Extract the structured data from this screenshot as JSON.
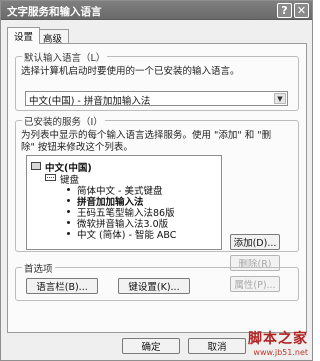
{
  "window": {
    "title": "文字服务和输入语言",
    "help_button": "?",
    "close_button": "✕"
  },
  "tabs": [
    "设置",
    "高级"
  ],
  "default_lang": {
    "group_label": "默认输入语言（L）",
    "description": "选择计算机启动时要使用的一个已安装的输入语言。",
    "selected_value": "中文(中国) - 拼音加加输入法"
  },
  "installed": {
    "group_label": "已安装的服务（I）",
    "description_line1": "为列表中显示的每个输入语言选择服务。使用 \"添加\" 和 \"删",
    "description_line2": "除\" 按钮来修改这个列表。",
    "language": "中文(中国)",
    "category": "键盘",
    "services": [
      {
        "label": "简体中文 - 美式键盘",
        "bold": false
      },
      {
        "label": "拼音加加输入法",
        "bold": true
      },
      {
        "label": "王码五笔型输入法86版",
        "bold": false
      },
      {
        "label": "微软拼音输入法3.0版",
        "bold": false
      },
      {
        "label": "中文 (简体) - 智能 ABC",
        "bold": false
      }
    ],
    "buttons": {
      "add": "添加(D)...",
      "remove": "删除(R)",
      "properties": "属性(P)..."
    }
  },
  "preferences": {
    "group_label": "首选项",
    "language_bar": "语言栏(B)...",
    "key_settings": "键设置(K)..."
  },
  "footer": {
    "ok": "确定",
    "cancel": "取消"
  },
  "watermark": {
    "title": "脚本之家",
    "url": "www.jb51.net"
  }
}
